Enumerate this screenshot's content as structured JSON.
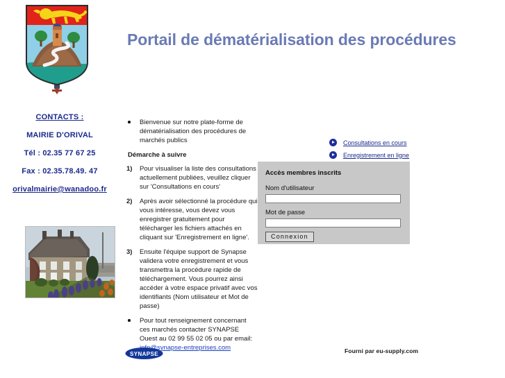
{
  "header": {
    "title": "Portail de dématérialisation des procédures",
    "crest_alt": "Blason d'Orival"
  },
  "contacts": {
    "heading": "CONTACTS :",
    "organisation": "MAIRIE D'ORIVAL",
    "phone": "Tél : 02.35 77 67 25",
    "fax": "Fax : 02.35.78.49. 47",
    "email": "orivalmairie@wanadoo.fr",
    "photo_alt": "Photo de la mairie d'Orival"
  },
  "main": {
    "intro": "Bienvenue sur notre plate-forme de dématérialisation des procédures de marchés publics",
    "subheading": "Démarche à suivre",
    "steps": [
      {
        "number": "1)",
        "text": "Pour visualiser la liste des consultations actuellement publiées, veuillez cliquer sur 'Consultations en cours'"
      },
      {
        "number": "2)",
        "text": "Après avoir sélectionné la procédure qui vous intéresse, vous devez vous enregistrer gratuitement pour télécharger les fichiers attachés en cliquant sur 'Enregistrement en ligne'."
      },
      {
        "number": "3)",
        "text": "Ensuite l'équipe support de Synapse validera votre enregistrement et vous transmettra la procédure rapide de téléchargement. Vous pourrez ainsi accéder à votre espace privatif avec vos identifiants (Nom utilisateur et Mot de passe)"
      }
    ],
    "support": {
      "text": "Pour tout renseignement concernant ces marchés contacter SYNAPSE Ouest au 02 99 55 02 05 ou par email:",
      "email": "info@synapse-entreprises.com"
    }
  },
  "quick_links": [
    {
      "label": "Consultations en cours",
      "icon": "play-circle-icon"
    },
    {
      "label": "Enregistrement en ligne",
      "icon": "play-circle-icon"
    }
  ],
  "login": {
    "title": "Accès membres inscrits",
    "username_label": "Nom d'utilisateur",
    "username_value": "",
    "username_placeholder": "",
    "password_label": "Mot de passe",
    "password_value": "",
    "password_placeholder": "",
    "submit_label": "Connexion"
  },
  "footer": {
    "logo_text": "SYNAPSE",
    "provider": "Fourni par eu-supply.com"
  },
  "colors": {
    "title": "#6a7ab5",
    "link": "#1b2a8c",
    "panel_bg": "#c8c8c8",
    "icon": "#1c2f9e",
    "logo": "#14379b"
  }
}
